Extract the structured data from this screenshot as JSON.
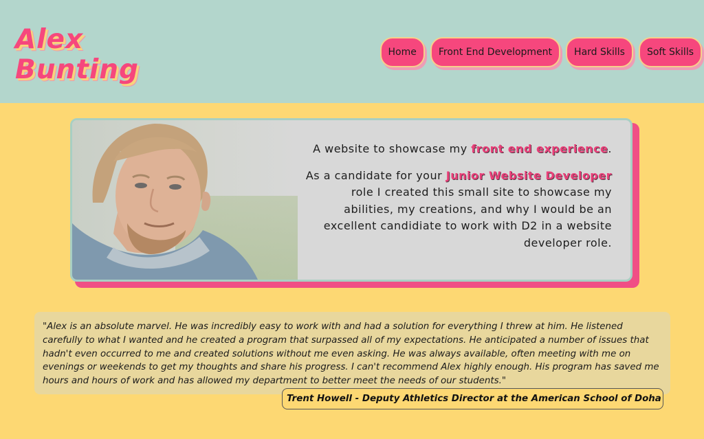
{
  "logo": {
    "line1": "Alex",
    "line2": "Bunting"
  },
  "nav": {
    "items": [
      {
        "label": "Home"
      },
      {
        "label": "Front End Development"
      },
      {
        "label": "Hard Skills"
      },
      {
        "label": "Soft Skills"
      }
    ]
  },
  "hero": {
    "line1_pre": "A website to showcase my ",
    "line1_highlight": "front end experience",
    "line1_post": ".",
    "line2_pre": "As a candidate for your ",
    "line2_highlight": "Junior Website Developer",
    "line2_post": " role I created this small site to showcase my abilities, my creations, and why I would be an excellent candidiate to work with D2 in a website developer role."
  },
  "testimonial": {
    "quote": "\"Alex is an absolute marvel. He was incredibly easy to work with and had a solution for everything I threw at him. He listened carefully to what I wanted and he created a program that surpassed all of my expectations. He anticipated a number of issues that hadn't even occurred to me and created solutions without me even asking. He was always available, often meeting with me on evenings or weekends to get my thoughts and share his progress. I can't recommend Alex highly enough. His program has saved me hours and hours of work and has allowed my department to better meet the needs of our students.\"",
    "author": "Trent Howell - Deputy Athletics Director at the American School of Doha"
  },
  "colors": {
    "page_bg": "#fdd873",
    "header_bg": "#b3d6cc",
    "accent_pink": "#f6477d",
    "card_bg": "#d8d8d8",
    "testimonial_bg": "#e8d79d"
  }
}
